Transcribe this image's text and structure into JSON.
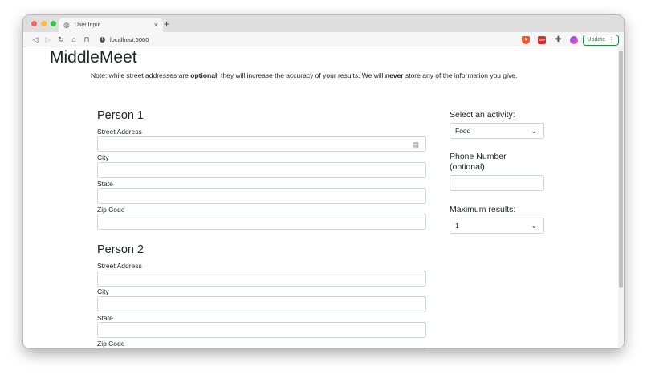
{
  "browser": {
    "tab_title": "User Input",
    "tab_close": "×",
    "new_tab": "+",
    "url": "localhost:5000",
    "update_label": "Update",
    "red_ext_label": "ABP"
  },
  "page": {
    "brand": "MiddleMeet",
    "note": {
      "part1": "Note: while street addresses are ",
      "bold1": "optional",
      "part2": ", they will increase the accuracy of your results. We will ",
      "bold2": "never",
      "part3": " store any of the information you give."
    },
    "person1": {
      "title": "Person 1",
      "street_label": "Street Address",
      "city_label": "City",
      "state_label": "State",
      "zip_label": "Zip Code"
    },
    "person2": {
      "title": "Person 2",
      "street_label": "Street Address",
      "city_label": "City",
      "state_label": "State",
      "zip_label": "Zip Code"
    },
    "activity": {
      "label": "Select an activity:",
      "selected": "Food"
    },
    "phone": {
      "label_line1": "Phone Number",
      "label_line2": "(optional)"
    },
    "max_results": {
      "label": "Maximum results:",
      "selected": "1"
    }
  },
  "colors": {
    "accent_green": "#1e8e3e",
    "text": "#212529",
    "input_border": "#ced4da"
  },
  "icons": [
    "globe-icon",
    "close-icon",
    "back-icon",
    "forward-icon",
    "reload-icon",
    "home-icon",
    "bookmark-icon",
    "info-icon",
    "brave-icon",
    "puzzle-icon",
    "address-card-icon",
    "chevron-down-icon"
  ]
}
